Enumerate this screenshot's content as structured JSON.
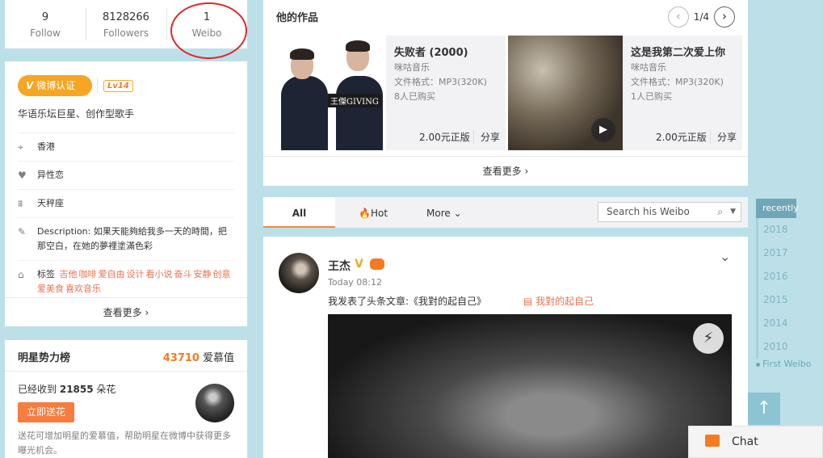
{
  "stats": [
    {
      "value": "9",
      "label": "Follow"
    },
    {
      "value": "8128266",
      "label": "Followers"
    },
    {
      "value": "1",
      "label": "Weibo"
    }
  ],
  "profile": {
    "v_badge_label": "微博认证",
    "level": "Lv14",
    "verification": "华语乐坛巨星、创作型歌手",
    "location": "香港",
    "orientation": "异性恋",
    "zodiac": "天秤座",
    "description": "Description: 如果天能夠給我多一天的時間，把那空白，在她的夢裡塗滿色彩",
    "tags_label": "标签",
    "tags": [
      "吉他",
      "咖啡",
      "爱自由",
      "设计",
      "看小说",
      "奋斗",
      "安静",
      "创意",
      "爱美食",
      "喜欢音乐"
    ],
    "more": "查看更多"
  },
  "star_power": {
    "title": "明星势力榜",
    "value": "43710",
    "value_unit": "爱慕值",
    "received_prefix": "已经收到",
    "received_count": "21855",
    "received_unit": "朵花",
    "send_button": "立即送花",
    "description": "送花可增加明星的爱慕值，帮助明星在微博中获得更多曝光机会。"
  },
  "works": {
    "title": "他的作品",
    "page": "1/4",
    "more": "查看更多",
    "albums": [
      {
        "title": "失败者 (2000)",
        "source": "咪咕音乐",
        "format": "文件格式：MP3(320K)",
        "buyers": "8人已购买",
        "price": "2.00元正版",
        "share": "分享",
        "cover_text": "王傑GIVING"
      },
      {
        "title": "这是我第二次爱上你",
        "source": "咪咕音乐",
        "format": "文件格式：MP3(320K)",
        "buyers": "1人已购买",
        "price": "2.00元正版",
        "share": "分享"
      }
    ]
  },
  "tabs": {
    "all": "All",
    "hot": "Hot",
    "more": "More",
    "search_placeholder": "Search his Weibo"
  },
  "post": {
    "author": "王杰",
    "time": "Today 08:12",
    "text": "我发表了头条文章:《我對的起自己》",
    "link": "我對的起自己"
  },
  "timeline": {
    "recent": "recently",
    "years": [
      "2018",
      "2017",
      "2016",
      "2015",
      "2014",
      "2010"
    ],
    "first": "First Weibo"
  },
  "chat": {
    "label": "Chat"
  },
  "colors": {
    "accent": "#f57b23",
    "background": "#bde0e8",
    "highlight_circle": "#e32626"
  }
}
